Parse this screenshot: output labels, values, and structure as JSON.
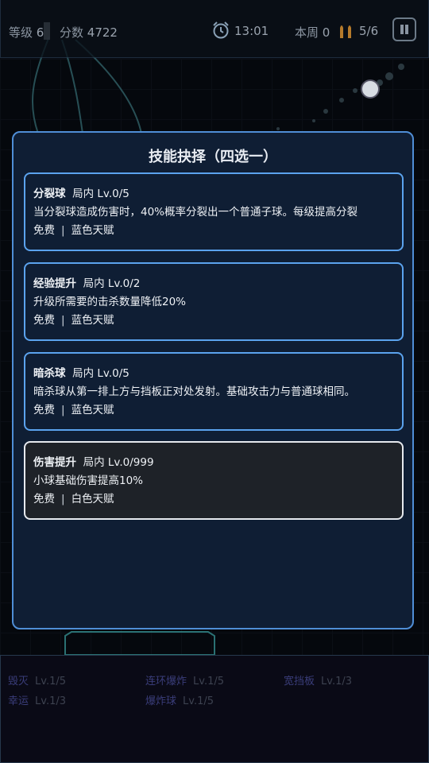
{
  "hud": {
    "level_label": "等级",
    "level_value": "6",
    "score_label": "分数",
    "score_value": "4722",
    "time": "13:01",
    "round_label": "本周",
    "round_value": "0",
    "ammo": "5/6"
  },
  "modal": {
    "title": "技能抉择（四选一）",
    "cards": [
      {
        "name": "分裂球",
        "scope": "局内",
        "level": "Lv.0/5",
        "desc": "当分裂球造成伤害时，40%概率分裂出一个普通子球。每级提高分裂",
        "cost": "免费",
        "sep": "|",
        "tier": "蓝色天赋",
        "color": "blue"
      },
      {
        "name": "经验提升",
        "scope": "局内",
        "level": "Lv.0/2",
        "desc": "升级所需要的击杀数量降低20%",
        "cost": "免费",
        "sep": "|",
        "tier": "蓝色天赋",
        "color": "blue"
      },
      {
        "name": "暗杀球",
        "scope": "局内",
        "level": "Lv.0/5",
        "desc": "暗杀球从第一排上方与挡板正对处发射。基础攻击力与普通球相同。",
        "cost": "免费",
        "sep": "|",
        "tier": "蓝色天赋",
        "color": "blue"
      },
      {
        "name": "伤害提升",
        "scope": "局内",
        "level": "Lv.0/999",
        "desc": "小球基础伤害提高10%",
        "cost": "免费",
        "sep": "|",
        "tier": "白色天赋",
        "color": "white"
      }
    ]
  },
  "skillbar": {
    "slots": [
      {
        "name": "毁灭",
        "level": "Lv.1/5"
      },
      {
        "name": "连环爆炸",
        "level": "Lv.1/5"
      },
      {
        "name": "宽挡板",
        "level": "Lv.1/3"
      },
      {
        "name": "幸运",
        "level": "Lv.1/3"
      },
      {
        "name": "爆炸球",
        "level": "Lv.1/5"
      }
    ]
  },
  "colors": {
    "modal_bg": "#0f1e34",
    "blue_border": "#5ba3ee",
    "white_border": "#e6e9ee"
  },
  "icons": [
    "alarm-clock-icon",
    "bullets-icon",
    "pause-icon"
  ]
}
